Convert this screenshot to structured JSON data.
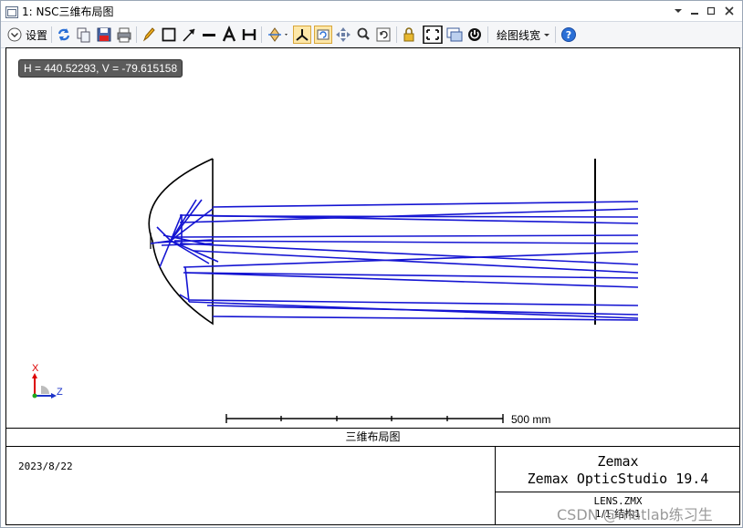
{
  "window": {
    "title": "1: NSC三维布局图",
    "controls": [
      "chevron-down-icon",
      "minimize-icon",
      "maximize-icon",
      "close-icon"
    ]
  },
  "toolbar": {
    "settings_label": "设置",
    "linewidth_label": "绘图线宽"
  },
  "canvas": {
    "coord_readout": "H = 440.52293, V = -79.615158",
    "scale_label": "500 mm",
    "axis_x_label": "X",
    "axis_z_label": "Z",
    "plot_title": "三维布局图",
    "date": "2023/8/22",
    "company": "Zemax",
    "product": "Zemax OpticStudio 19.4",
    "file_name": "LENS.ZMX",
    "config": "1/1 结构1"
  },
  "watermark": "CSDN @matlab练习生",
  "colors": {
    "ray": "#1414d2",
    "geometry": "#000000",
    "readout_bg": "#5b5b5b"
  }
}
